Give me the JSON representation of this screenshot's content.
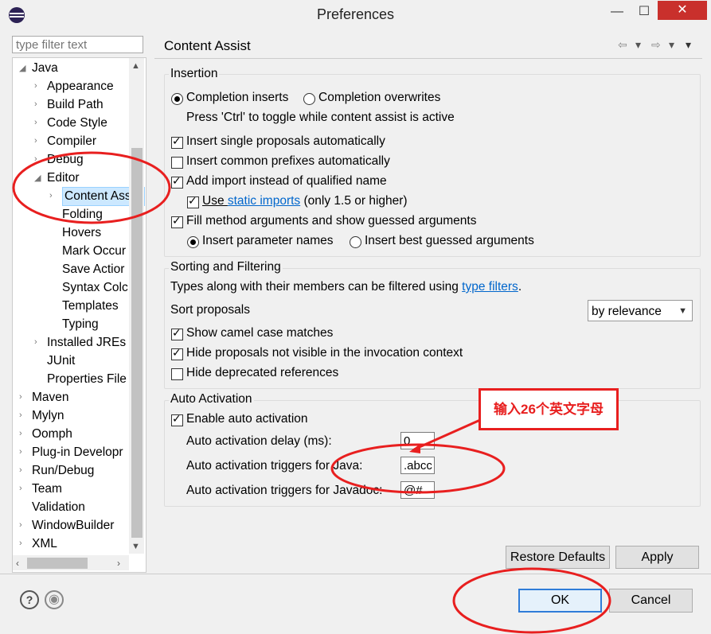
{
  "window": {
    "title": "Preferences",
    "minimize": "—",
    "maximize": "☐",
    "close": "✕"
  },
  "sidebar": {
    "filter_placeholder": "type filter text",
    "items": [
      {
        "label": "Java",
        "level": 0,
        "arrow": "◢",
        "y": 0
      },
      {
        "label": "Appearance",
        "level": 1,
        "arrow": "›",
        "y": 1
      },
      {
        "label": "Build Path",
        "level": 1,
        "arrow": "›",
        "y": 2
      },
      {
        "label": "Code Style",
        "level": 1,
        "arrow": "›",
        "y": 3
      },
      {
        "label": "Compiler",
        "level": 1,
        "arrow": "›",
        "y": 4
      },
      {
        "label": "Debug",
        "level": 1,
        "arrow": "›",
        "y": 5
      },
      {
        "label": "Editor",
        "level": 1,
        "arrow": "◢",
        "y": 6
      },
      {
        "label": "Content Ass",
        "level": 2,
        "arrow": "›",
        "y": 7,
        "selected": true
      },
      {
        "label": "Folding",
        "level": 2,
        "arrow": "",
        "y": 8
      },
      {
        "label": "Hovers",
        "level": 2,
        "arrow": "",
        "y": 9
      },
      {
        "label": "Mark Occur",
        "level": 2,
        "arrow": "",
        "y": 10
      },
      {
        "label": "Save Actior",
        "level": 2,
        "arrow": "",
        "y": 11
      },
      {
        "label": "Syntax Colc",
        "level": 2,
        "arrow": "",
        "y": 12
      },
      {
        "label": "Templates",
        "level": 2,
        "arrow": "",
        "y": 13
      },
      {
        "label": "Typing",
        "level": 2,
        "arrow": "",
        "y": 14
      },
      {
        "label": "Installed JREs",
        "level": 1,
        "arrow": "›",
        "y": 15
      },
      {
        "label": "JUnit",
        "level": 1,
        "arrow": "",
        "y": 16
      },
      {
        "label": "Properties File",
        "level": 1,
        "arrow": "",
        "y": 17
      },
      {
        "label": "Maven",
        "level": 0,
        "arrow": "›",
        "y": 18
      },
      {
        "label": "Mylyn",
        "level": 0,
        "arrow": "›",
        "y": 19
      },
      {
        "label": "Oomph",
        "level": 0,
        "arrow": "›",
        "y": 20
      },
      {
        "label": "Plug-in Developr",
        "level": 0,
        "arrow": "›",
        "y": 21
      },
      {
        "label": "Run/Debug",
        "level": 0,
        "arrow": "›",
        "y": 22
      },
      {
        "label": "Team",
        "level": 0,
        "arrow": "›",
        "y": 23
      },
      {
        "label": "Validation",
        "level": 0,
        "arrow": "",
        "y": 24
      },
      {
        "label": "WindowBuilder",
        "level": 0,
        "arrow": "›",
        "y": 25
      },
      {
        "label": "XML",
        "level": 0,
        "arrow": "›",
        "y": 26
      }
    ]
  },
  "page": {
    "title": "Content Assist",
    "nav_back": "⇦",
    "nav_forward": "⇨",
    "nav_dropdown": "▾",
    "nav_menu": "▾"
  },
  "insertion": {
    "label": "Insertion",
    "completion_inserts": "Completion inserts",
    "completion_overwrites": "Completion overwrites",
    "toggle_hint": "Press 'Ctrl' to toggle while content assist is active",
    "insert_single": "Insert single proposals automatically",
    "insert_common": "Insert common prefixes automatically",
    "add_import": "Add import instead of qualified name",
    "use_prefix": "Use ",
    "static_imports": "static imports",
    "use_suffix": " (only 1.5 or higher)",
    "fill_args": "Fill method arguments and show guessed arguments",
    "insert_param_names": "Insert parameter names",
    "insert_best_guessed": "Insert best guessed arguments"
  },
  "sorting": {
    "label": "Sorting and Filtering",
    "types_text": "Types along with their members can be filtered using ",
    "type_filters": "type filters",
    "period": ".",
    "sort_proposals": "Sort proposals",
    "sort_value": "by relevance",
    "show_camel": "Show camel case matches",
    "hide_not_visible": "Hide proposals not visible in the invocation context",
    "hide_deprecated": "Hide deprecated references"
  },
  "auto_activation": {
    "label": "Auto Activation",
    "enable": "Enable auto activation",
    "delay_label": "Auto activation delay (ms):",
    "delay_value": "0",
    "java_triggers_label": "Auto activation triggers for Java:",
    "java_triggers_value": ".abcc",
    "javadoc_triggers_label": "Auto activation triggers for Javadoc:",
    "javadoc_triggers_value": "@#"
  },
  "annotation": {
    "text": "输入26个英文字母"
  },
  "buttons": {
    "restore_defaults": "Restore Defaults",
    "apply": "Apply",
    "ok": "OK",
    "cancel": "Cancel",
    "help": "?",
    "record": "◉"
  },
  "colors": {
    "annotation_red": "#e81f1f",
    "link": "#0066cc",
    "selection": "#cce8ff"
  }
}
